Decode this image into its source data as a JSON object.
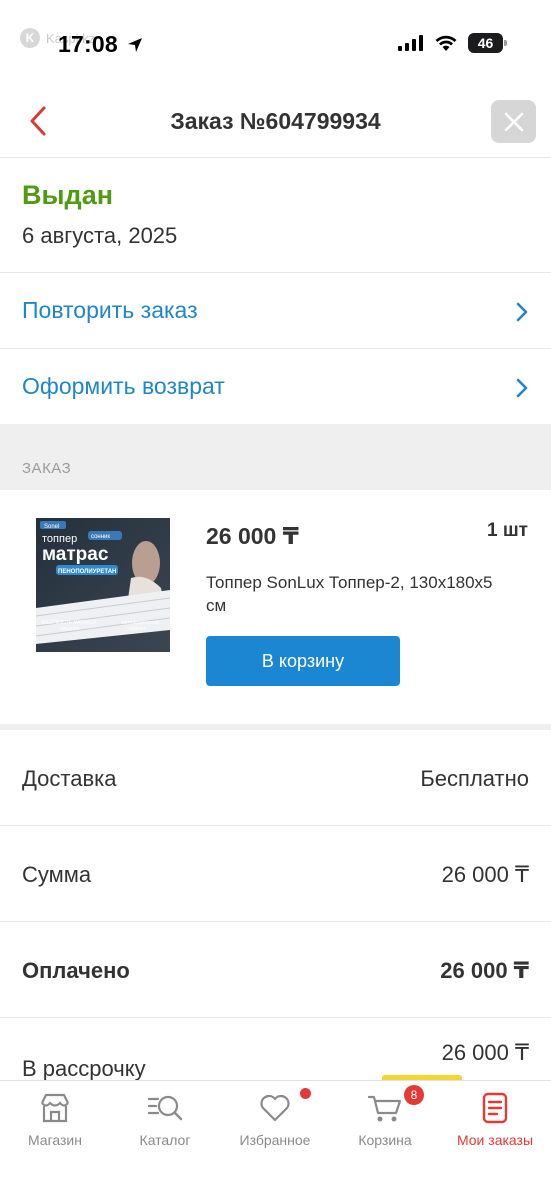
{
  "status_bar": {
    "watermark": "Kaspi.kz",
    "time": "17:08",
    "battery": "46"
  },
  "header": {
    "title": "Заказ №604799934"
  },
  "order": {
    "status": "Выдан",
    "date": "6 августа, 2025",
    "status_color": "#4f9b12"
  },
  "actions": [
    {
      "label": "Повторить заказ"
    },
    {
      "label": "Оформить возврат"
    }
  ],
  "section_label": "ЗАКАЗ",
  "product": {
    "price": "26 000 ₸",
    "quantity": "1 шт",
    "name": "Топпер SonLux Топпер-2, 130x180x5 см",
    "cart_button": "В корзину",
    "image_text": {
      "brand": "Sonel",
      "title_top": "топпер",
      "title_main": "матрас",
      "tag": "сонник",
      "material": "ПЕНОПОЛИУРЕТАН",
      "feature_1": "ЖЕСТКОСТЬ МАТРАСА",
      "feature_1_value": "средняя",
      "feature_2": "ортопедический",
      "feature_2_value": "эффект"
    }
  },
  "summary": [
    {
      "label": "Доставка",
      "value": "Бесплатно",
      "bold": false
    },
    {
      "label": "Сумма",
      "value": "26 000 ₸",
      "bold": false
    },
    {
      "label": "Оплачено",
      "value": "26 000 ₸",
      "bold": true
    },
    {
      "label": "В рассрочку",
      "value": "26 000 ₸",
      "bold": false
    }
  ],
  "tabbar": {
    "tabs": [
      {
        "label": "Магазин",
        "icon": "store-icon"
      },
      {
        "label": "Каталог",
        "icon": "catalog-search-icon"
      },
      {
        "label": "Избранное",
        "icon": "heart-icon"
      },
      {
        "label": "Корзина",
        "icon": "cart-icon",
        "badge": "8"
      },
      {
        "label": "Мои заказы",
        "icon": "orders-icon",
        "active": true
      }
    ]
  },
  "colors": {
    "accent_blue": "#1f86c8",
    "button_blue": "#1b86d2",
    "active_red": "#e53935",
    "status_green": "#4f9b12"
  }
}
